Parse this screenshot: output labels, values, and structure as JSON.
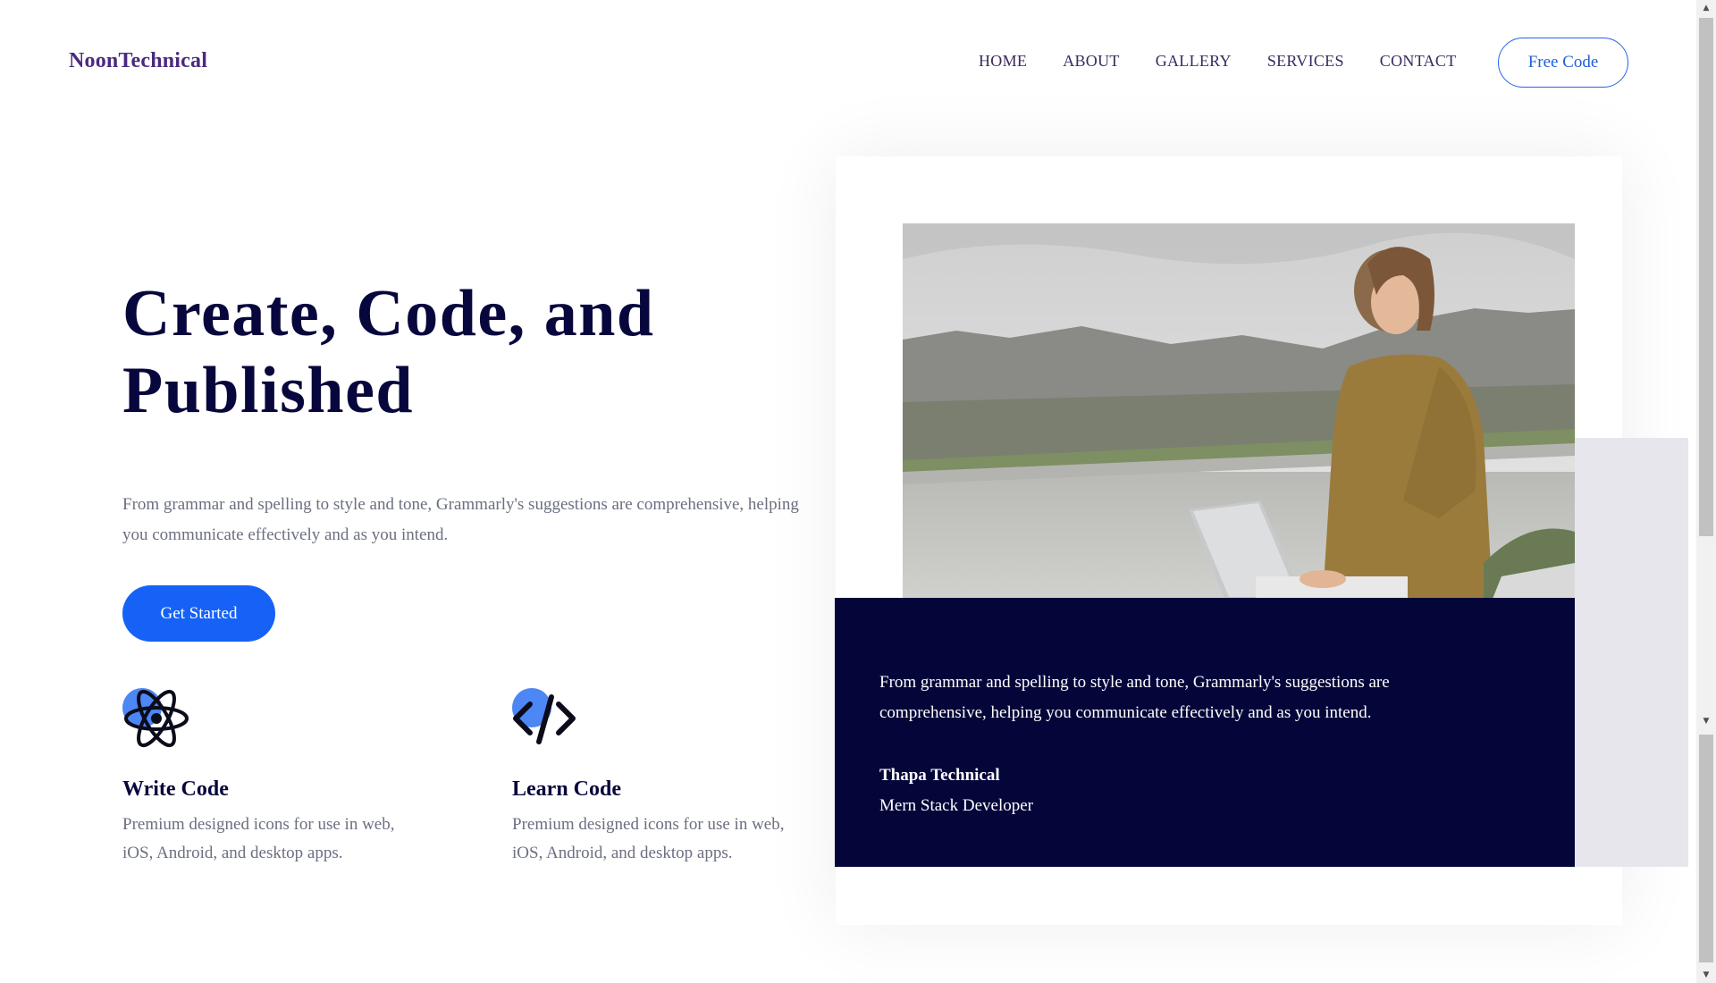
{
  "header": {
    "logo": "NoonTechnical",
    "nav": [
      "HOME",
      "ABOUT",
      "GALLERY",
      "SERVICES",
      "CONTACT"
    ],
    "cta_label": "Free Code"
  },
  "hero": {
    "title_line1": "Create, Code, and",
    "title_line2": "Published",
    "text": "From grammar and spelling to style and tone, Grammarly's suggestions are comprehensive, helping you communicate effectively and as you intend.",
    "button_label": "Get Started"
  },
  "features": [
    {
      "icon": "atom-icon",
      "title": "Write Code",
      "text": "Premium designed icons for use in web, iOS, Android, and desktop apps."
    },
    {
      "icon": "code-icon",
      "title": "Learn Code",
      "text": "Premium designed icons for use in web, iOS, Android, and desktop apps."
    }
  ],
  "testimonial": {
    "text": "From grammar and spelling to style and tone, Grammarly's suggestions are comprehensive, helping you communicate effectively and as you intend.",
    "name": "Thapa Technical",
    "role": "Mern Stack Developer"
  },
  "colors": {
    "brand": "#4b2a7f",
    "primary": "#1662f6",
    "navy": "#04063a",
    "muted": "#6b6f80"
  }
}
